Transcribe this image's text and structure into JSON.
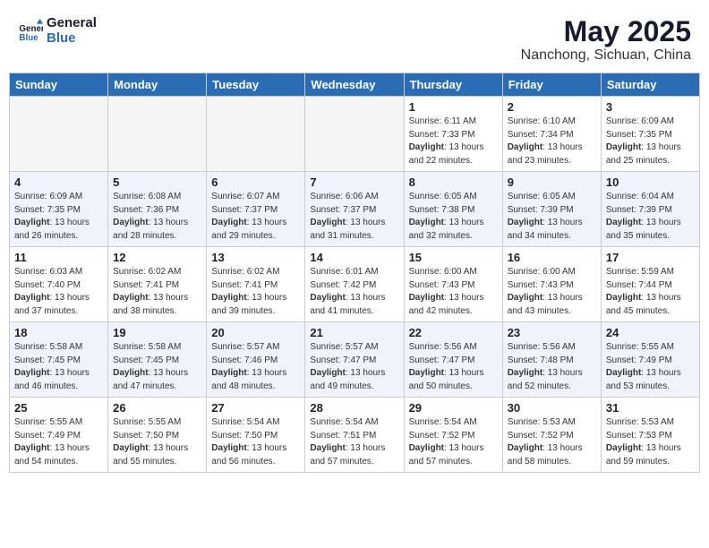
{
  "logo": {
    "line1": "General",
    "line2": "Blue"
  },
  "title": "May 2025",
  "subtitle": "Nanchong, Sichuan, China",
  "weekdays": [
    "Sunday",
    "Monday",
    "Tuesday",
    "Wednesday",
    "Thursday",
    "Friday",
    "Saturday"
  ],
  "weeks": [
    [
      {
        "day": "",
        "info": ""
      },
      {
        "day": "",
        "info": ""
      },
      {
        "day": "",
        "info": ""
      },
      {
        "day": "",
        "info": ""
      },
      {
        "day": "1",
        "info": "Sunrise: 6:11 AM\nSunset: 7:33 PM\nDaylight: 13 hours\nand 22 minutes."
      },
      {
        "day": "2",
        "info": "Sunrise: 6:10 AM\nSunset: 7:34 PM\nDaylight: 13 hours\nand 23 minutes."
      },
      {
        "day": "3",
        "info": "Sunrise: 6:09 AM\nSunset: 7:35 PM\nDaylight: 13 hours\nand 25 minutes."
      }
    ],
    [
      {
        "day": "4",
        "info": "Sunrise: 6:09 AM\nSunset: 7:35 PM\nDaylight: 13 hours\nand 26 minutes."
      },
      {
        "day": "5",
        "info": "Sunrise: 6:08 AM\nSunset: 7:36 PM\nDaylight: 13 hours\nand 28 minutes."
      },
      {
        "day": "6",
        "info": "Sunrise: 6:07 AM\nSunset: 7:37 PM\nDaylight: 13 hours\nand 29 minutes."
      },
      {
        "day": "7",
        "info": "Sunrise: 6:06 AM\nSunset: 7:37 PM\nDaylight: 13 hours\nand 31 minutes."
      },
      {
        "day": "8",
        "info": "Sunrise: 6:05 AM\nSunset: 7:38 PM\nDaylight: 13 hours\nand 32 minutes."
      },
      {
        "day": "9",
        "info": "Sunrise: 6:05 AM\nSunset: 7:39 PM\nDaylight: 13 hours\nand 34 minutes."
      },
      {
        "day": "10",
        "info": "Sunrise: 6:04 AM\nSunset: 7:39 PM\nDaylight: 13 hours\nand 35 minutes."
      }
    ],
    [
      {
        "day": "11",
        "info": "Sunrise: 6:03 AM\nSunset: 7:40 PM\nDaylight: 13 hours\nand 37 minutes."
      },
      {
        "day": "12",
        "info": "Sunrise: 6:02 AM\nSunset: 7:41 PM\nDaylight: 13 hours\nand 38 minutes."
      },
      {
        "day": "13",
        "info": "Sunrise: 6:02 AM\nSunset: 7:41 PM\nDaylight: 13 hours\nand 39 minutes."
      },
      {
        "day": "14",
        "info": "Sunrise: 6:01 AM\nSunset: 7:42 PM\nDaylight: 13 hours\nand 41 minutes."
      },
      {
        "day": "15",
        "info": "Sunrise: 6:00 AM\nSunset: 7:43 PM\nDaylight: 13 hours\nand 42 minutes."
      },
      {
        "day": "16",
        "info": "Sunrise: 6:00 AM\nSunset: 7:43 PM\nDaylight: 13 hours\nand 43 minutes."
      },
      {
        "day": "17",
        "info": "Sunrise: 5:59 AM\nSunset: 7:44 PM\nDaylight: 13 hours\nand 45 minutes."
      }
    ],
    [
      {
        "day": "18",
        "info": "Sunrise: 5:58 AM\nSunset: 7:45 PM\nDaylight: 13 hours\nand 46 minutes."
      },
      {
        "day": "19",
        "info": "Sunrise: 5:58 AM\nSunset: 7:45 PM\nDaylight: 13 hours\nand 47 minutes."
      },
      {
        "day": "20",
        "info": "Sunrise: 5:57 AM\nSunset: 7:46 PM\nDaylight: 13 hours\nand 48 minutes."
      },
      {
        "day": "21",
        "info": "Sunrise: 5:57 AM\nSunset: 7:47 PM\nDaylight: 13 hours\nand 49 minutes."
      },
      {
        "day": "22",
        "info": "Sunrise: 5:56 AM\nSunset: 7:47 PM\nDaylight: 13 hours\nand 50 minutes."
      },
      {
        "day": "23",
        "info": "Sunrise: 5:56 AM\nSunset: 7:48 PM\nDaylight: 13 hours\nand 52 minutes."
      },
      {
        "day": "24",
        "info": "Sunrise: 5:55 AM\nSunset: 7:49 PM\nDaylight: 13 hours\nand 53 minutes."
      }
    ],
    [
      {
        "day": "25",
        "info": "Sunrise: 5:55 AM\nSunset: 7:49 PM\nDaylight: 13 hours\nand 54 minutes."
      },
      {
        "day": "26",
        "info": "Sunrise: 5:55 AM\nSunset: 7:50 PM\nDaylight: 13 hours\nand 55 minutes."
      },
      {
        "day": "27",
        "info": "Sunrise: 5:54 AM\nSunset: 7:50 PM\nDaylight: 13 hours\nand 56 minutes."
      },
      {
        "day": "28",
        "info": "Sunrise: 5:54 AM\nSunset: 7:51 PM\nDaylight: 13 hours\nand 57 minutes."
      },
      {
        "day": "29",
        "info": "Sunrise: 5:54 AM\nSunset: 7:52 PM\nDaylight: 13 hours\nand 57 minutes."
      },
      {
        "day": "30",
        "info": "Sunrise: 5:53 AM\nSunset: 7:52 PM\nDaylight: 13 hours\nand 58 minutes."
      },
      {
        "day": "31",
        "info": "Sunrise: 5:53 AM\nSunset: 7:53 PM\nDaylight: 13 hours\nand 59 minutes."
      }
    ]
  ]
}
